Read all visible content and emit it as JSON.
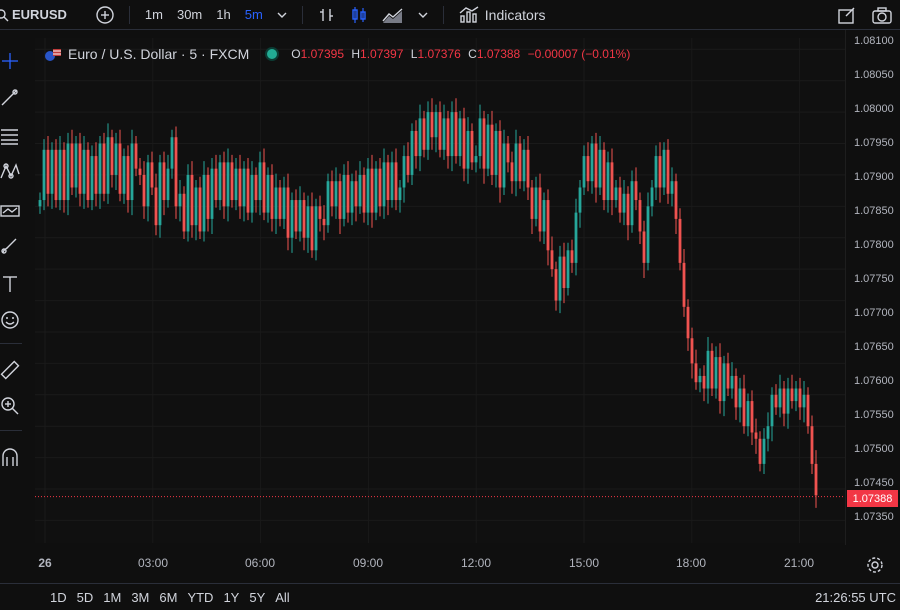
{
  "symbol": "EURUSD",
  "intervals": [
    "1m",
    "30m",
    "1h",
    "5m"
  ],
  "active_interval": "5m",
  "indicators_label": "Indicators",
  "legend": {
    "title": "Euro / U.S. Dollar · 5 · FXCM",
    "o_label": "O",
    "o": "1.07395",
    "h_label": "H",
    "h": "1.07397",
    "l_label": "L",
    "l": "1.07376",
    "c_label": "C",
    "c": "1.07388",
    "change": "−0.00007 (−0.01%)"
  },
  "price_axis": [
    "1.08100",
    "1.08050",
    "1.08000",
    "1.07950",
    "1.07900",
    "1.07850",
    "1.07800",
    "1.07750",
    "1.07700",
    "1.07650",
    "1.07600",
    "1.07550",
    "1.07500",
    "1.07450",
    "1.07400",
    "1.07350"
  ],
  "current_price": "1.07388",
  "time_axis": [
    "26",
    "03:00",
    "06:00",
    "09:00",
    "12:00",
    "15:00",
    "18:00",
    "21:00"
  ],
  "ranges": [
    "1D",
    "5D",
    "1M",
    "3M",
    "6M",
    "YTD",
    "1Y",
    "5Y",
    "All"
  ],
  "clock": "21:26:55 UTC",
  "colors": {
    "up": "#26a69a",
    "down": "#ef5350",
    "accent": "#2962ff"
  },
  "chart_data": {
    "type": "candlestick",
    "title": "Euro / U.S. Dollar · 5 · FXCM",
    "ylim": [
      1.0733,
      1.0811
    ],
    "series": [
      {
        "x": [
          "26",
          "03:00",
          "06:00",
          "09:00",
          "12:00",
          "15:00",
          "18:00",
          "21:00"
        ],
        "close": [
          1.0786,
          1.0794,
          1.0787,
          1.0794,
          1.0786,
          1.0794,
          1.0786,
          1.0795,
          1.0788,
          1.0795,
          1.0787,
          1.0794,
          1.0786,
          1.0793,
          1.0787,
          1.0795,
          1.0787,
          1.0796,
          1.079,
          1.0795,
          1.0787,
          1.0793,
          1.0786,
          1.0795,
          1.0791,
          1.079,
          1.0785,
          1.0792,
          1.0788,
          1.0782,
          1.0792,
          1.0786,
          1.0791,
          1.0796,
          1.0785,
          1.0787,
          1.0781,
          1.079,
          1.0782,
          1.0788,
          1.0781,
          1.079,
          1.0783,
          1.0791,
          1.0786,
          1.0792,
          1.0785,
          1.0792,
          1.0786,
          1.0791,
          1.0785,
          1.0791,
          1.0784,
          1.079,
          1.0786,
          1.0792,
          1.0784,
          1.079,
          1.0783,
          1.0788,
          1.0783,
          1.0788,
          1.078,
          1.0786,
          1.0781,
          1.0786,
          1.078,
          1.0785,
          1.0778,
          1.0785,
          1.0783,
          1.0782,
          1.0789,
          1.0785,
          1.0789,
          1.0783,
          1.079,
          1.0784,
          1.0789,
          1.0785,
          1.079,
          1.0784,
          1.0791,
          1.0784,
          1.0791,
          1.0785,
          1.0792,
          1.0786,
          1.0792,
          1.0786,
          1.0788,
          1.0793,
          1.079,
          1.0797,
          1.0793,
          1.0799,
          1.0794,
          1.08,
          1.0796,
          1.08,
          1.0794,
          1.0799,
          1.0793,
          1.08,
          1.0793,
          1.0799,
          1.0791,
          1.0797,
          1.0792,
          1.0793,
          1.0799,
          1.0791,
          1.0798,
          1.079,
          1.0797,
          1.0788,
          1.0795,
          1.0792,
          1.0789,
          1.0795,
          1.0789,
          1.0794,
          1.0788,
          1.0783,
          1.0788,
          1.0781,
          1.0786,
          1.0778,
          1.0775,
          1.077,
          1.0777,
          1.0772,
          1.0778,
          1.0776,
          1.0784,
          1.0788,
          1.0793,
          1.0789,
          1.0795,
          1.0788,
          1.0794,
          1.0786,
          1.0792,
          1.0786,
          1.0788,
          1.0784,
          1.0787,
          1.0782,
          1.0789,
          1.0786,
          1.0781,
          1.0776,
          1.0785,
          1.0788,
          1.0793,
          1.0788,
          1.0794,
          1.0787,
          1.0789,
          1.0783,
          1.0776,
          1.0769,
          1.0764,
          1.076,
          1.0757,
          1.0758,
          1.0756,
          1.0762,
          1.0756,
          1.0761,
          1.0754,
          1.076,
          1.0756,
          1.0758,
          1.0753,
          1.0756,
          1.075,
          1.0754,
          1.0749,
          1.0748,
          1.0744,
          1.0748,
          1.075,
          1.0755,
          1.0753,
          1.0756,
          1.0752,
          1.0756,
          1.0754,
          1.0756,
          1.0753,
          1.0755,
          1.075,
          1.0744,
          1.0739
        ]
      }
    ]
  }
}
